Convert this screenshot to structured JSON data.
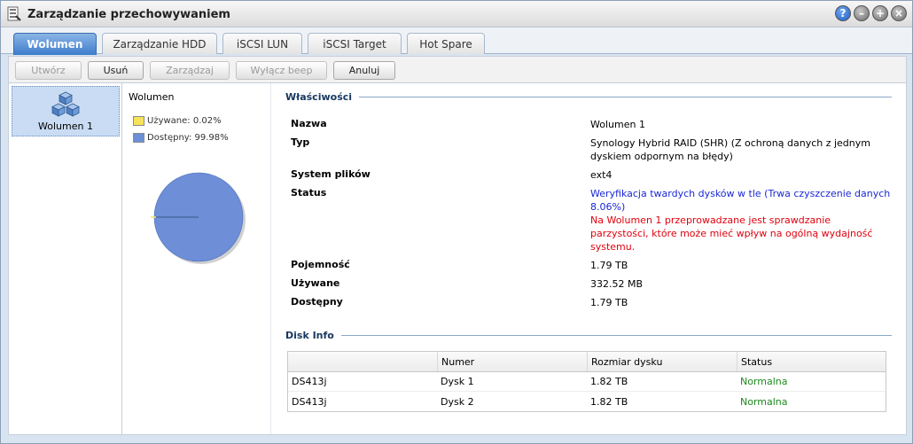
{
  "window": {
    "title": "Zarządzanie przechowywaniem"
  },
  "tabs": [
    {
      "label": "Wolumen",
      "active": true
    },
    {
      "label": "Zarządzanie HDD",
      "active": false
    },
    {
      "label": "iSCSI LUN",
      "active": false
    },
    {
      "label": "iSCSI Target",
      "active": false
    },
    {
      "label": "Hot Spare",
      "active": false
    }
  ],
  "toolbar": {
    "create": "Utwórz",
    "remove": "Usuń",
    "manage": "Zarządzaj",
    "beep_off": "Wyłącz beep",
    "cancel": "Anuluj"
  },
  "sidebar": {
    "items": [
      {
        "label": "Wolumen 1"
      }
    ]
  },
  "chart_data": {
    "type": "pie",
    "title": "Wolumen",
    "categories": [
      "Używane",
      "Dostępny"
    ],
    "values": [
      0.02,
      99.98
    ],
    "legend": [
      "Używane: 0.02%",
      "Dostępny: 99.98%"
    ],
    "colors": [
      "#f7e35a",
      "#6e8fd8"
    ],
    "legend_position": "top"
  },
  "properties": {
    "header": "Właściwości",
    "rows": [
      {
        "key": "Nazwa",
        "value": "Wolumen 1"
      },
      {
        "key": "Typ",
        "value": "Synology Hybrid RAID (SHR) (Z ochroną danych z jednym dyskiem odpornym na błędy)"
      },
      {
        "key": "System plików",
        "value": "ext4"
      },
      {
        "key": "Status",
        "value_blue": "Weryfikacja twardych dysków w tle",
        "value_blue2": "(Trwa czyszczenie danych 8.06%)",
        "value_red": "Na Wolumen 1 przeprowadzane jest sprawdzanie parzystości, które może mieć wpływ na ogólną wydajność systemu."
      },
      {
        "key": "Pojemność",
        "value": "1.79 TB"
      },
      {
        "key": "Używane",
        "value": "332.52 MB"
      },
      {
        "key": "Dostępny",
        "value": "1.79 TB"
      }
    ]
  },
  "disk_info": {
    "header": "Disk Info",
    "columns": [
      "",
      "Numer",
      "Rozmiar dysku",
      "Status"
    ],
    "rows": [
      [
        "DS413j",
        "Dysk 1",
        "1.82 TB",
        "Normalna"
      ],
      [
        "DS413j",
        "Dysk 2",
        "1.82 TB",
        "Normalna"
      ]
    ]
  },
  "colors": {
    "accent": "#3d7ccc",
    "status_ok": "#1c8a1c",
    "warning": "#e0000d",
    "info": "#1a28d6"
  }
}
